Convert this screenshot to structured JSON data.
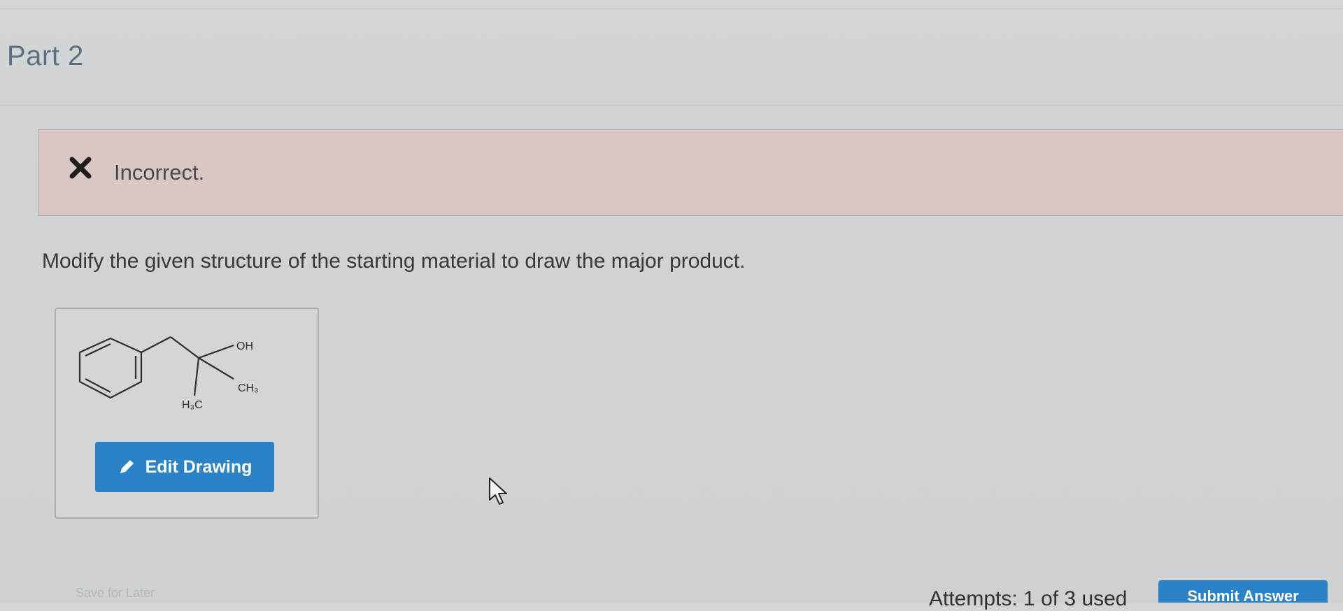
{
  "part": {
    "title": "Part 2"
  },
  "feedback": {
    "icon": "x-mark-icon",
    "status": "Incorrect.",
    "color_icon": "#1e1e1e",
    "color_background": "#d9c7c5"
  },
  "question": {
    "instruction": "Modify the given structure of the starting material to draw the major product."
  },
  "drawing": {
    "labels": {
      "oh": "OH",
      "ch3": "CH₃",
      "h3c": "H₃C"
    },
    "edit_button": {
      "icon": "pencil-icon",
      "label": "Edit Drawing"
    }
  },
  "footer": {
    "save_label": "Save for Later",
    "attempts": "Attempts: 1 of 3 used",
    "submit_label": "Submit Answer"
  },
  "colors": {
    "accent": "#2b82c6",
    "part_title": "#5e6f80"
  }
}
